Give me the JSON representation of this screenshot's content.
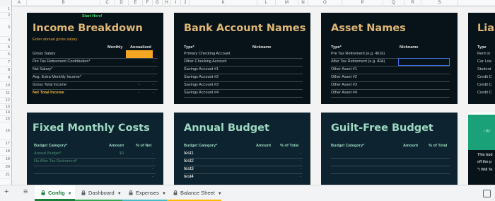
{
  "columns": [
    "A",
    "B",
    "C",
    "D",
    "E",
    "F",
    "G",
    "H",
    "I",
    "J",
    "K",
    "L",
    "M",
    "N",
    "O",
    "P",
    "Q",
    "R",
    "S"
  ],
  "rows": [
    "1",
    "2",
    "3",
    "4",
    "5",
    "6",
    "7",
    "8",
    "9",
    "10",
    "11",
    "12",
    "13",
    "14",
    "15",
    "16",
    "17",
    "18",
    "19",
    "20",
    "21"
  ],
  "income": {
    "start_here": "Start Here!",
    "title": "Income Breakdown",
    "instruction": "Enter annual gross salary",
    "col_monthly": "Monthly",
    "col_annualized": "Annualized",
    "rows": [
      "Gross Salary",
      "Pre Tax Retirement Contribution*",
      "Net Salary*",
      "Avg. Extra Monthly Income*",
      "Gross Total Income"
    ],
    "net_total": "Net Total Income",
    "dash": "-"
  },
  "bank": {
    "title": "Bank Account Names",
    "col_type": "Type*",
    "col_nickname": "Nickname",
    "rows": [
      "Primary Checking Account",
      "Other Checking Account",
      "Savings Account #1",
      "Savings Account #2",
      "Savings Account #3",
      "Savings Account #4"
    ]
  },
  "asset": {
    "title": "Asset Names",
    "col_type": "Type*",
    "col_nickname": "Nickname",
    "rows": [
      "Pre Tax Retirement (e.g. 401k)",
      "After Tax Retirement (e.g. IRA)",
      "Other Asset #1",
      "Other Asset #2",
      "Other Asset #3",
      "Other Asset #4"
    ]
  },
  "liab": {
    "title": "Liab",
    "col_type": "Type",
    "rows": [
      "Rent or",
      "Car Loa",
      "Student",
      "Credit C",
      "Credit C",
      "Credit C"
    ]
  },
  "fixed": {
    "title": "Fixed Monthly Costs",
    "col_category": "Budget Category*",
    "col_amount": "Amount",
    "col_pct": "% of Net",
    "row1_label": "Annual Budget*",
    "row1_amount": "$0",
    "row2_label": "No After Tax Retirement*",
    "dash": "-"
  },
  "annual": {
    "title": "Annual Budget",
    "col_category": "Budget Category*",
    "col_amount": "Amount",
    "col_pct": "% of Total",
    "rows": [
      "test1",
      "test2",
      "test3",
      "test4"
    ],
    "dash": "-"
  },
  "guilt": {
    "title": "Guilt-Free Budget",
    "col_category": "Budget Category*",
    "col_amount": "Amount",
    "col_pct": "% of Total"
  },
  "partial": {
    "lines": [
      "This bud",
      "off the p",
      "\"I Will Te"
    ],
    "logo_text": "/ W/"
  },
  "tabs": {
    "add_icon": "+",
    "list_icon": "≡",
    "sheets": [
      {
        "label": "Config",
        "active": true,
        "stripe": "#34a853"
      },
      {
        "label": "Dashboard",
        "active": false,
        "stripe": "#34a853"
      },
      {
        "label": "Expenses",
        "active": false,
        "stripe": "#46bdc6"
      },
      {
        "label": "Balance Sheet",
        "active": false,
        "stripe": "#fbbc04"
      }
    ]
  },
  "colors": {
    "card_dark": "#071318",
    "card_teal": "#0d2430",
    "gold_title": "#e0b775",
    "teal_title": "#9fd9c2",
    "orange_input": "#f5a623",
    "active_tab": "#188038"
  }
}
